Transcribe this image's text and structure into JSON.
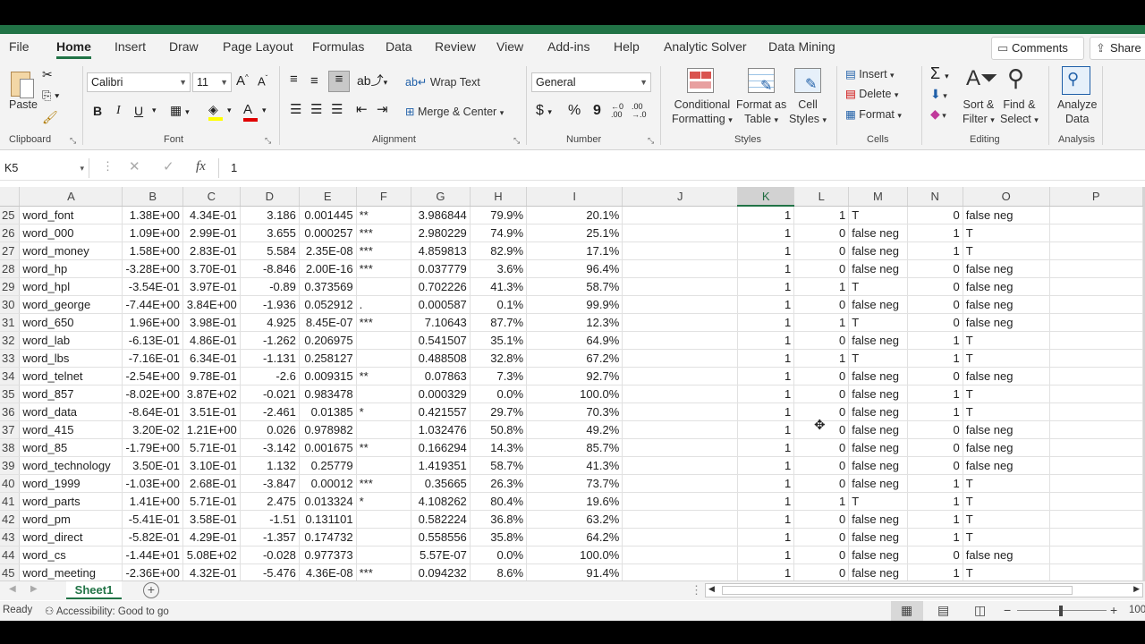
{
  "menu": {
    "tabs": [
      "File",
      "Home",
      "Insert",
      "Draw",
      "Page Layout",
      "Formulas",
      "Data",
      "Review",
      "View",
      "Add-ins",
      "Help",
      "Analytic Solver",
      "Data Mining"
    ],
    "active_tab": "Home",
    "comments_label": "Comments",
    "share_label": "Share"
  },
  "ribbon": {
    "clipboard": {
      "paste": "Paste",
      "label": "Clipboard"
    },
    "font": {
      "name": "Calibri",
      "size": "11",
      "grow": "A",
      "shrink": "A",
      "bold": "B",
      "italic": "I",
      "underline": "U",
      "label": "Font"
    },
    "alignment": {
      "wrap": "Wrap Text",
      "merge": "Merge & Center",
      "label": "Alignment"
    },
    "number": {
      "format": "General",
      "currency": "$",
      "percent": "%",
      "comma": "9",
      "label": "Number"
    },
    "styles": {
      "conditional1": "Conditional",
      "conditional2": "Formatting",
      "format_table1": "Format as",
      "format_table2": "Table",
      "cell_styles1": "Cell",
      "cell_styles2": "Styles",
      "label": "Styles"
    },
    "cells": {
      "insert": "Insert",
      "delete": "Delete",
      "format": "Format",
      "label": "Cells"
    },
    "editing": {
      "sort1": "Sort &",
      "sort2": "Filter",
      "find1": "Find &",
      "find2": "Select",
      "label": "Editing"
    },
    "analysis": {
      "analyze1": "Analyze",
      "analyze2": "Data",
      "label": "Analysis"
    }
  },
  "formula_bar": {
    "name_box": "K5",
    "fx": "fx",
    "value": "1"
  },
  "columns": [
    "A",
    "B",
    "C",
    "D",
    "E",
    "F",
    "G",
    "H",
    "I",
    "J",
    "K",
    "L",
    "M",
    "N",
    "O",
    "P"
  ],
  "selected_column": "K",
  "rows": [
    {
      "n": "25",
      "A": "word_font",
      "B": "1.38E+00",
      "C": "4.34E-01",
      "D": "3.186",
      "E": "0.001445",
      "F": "**",
      "G": "3.986844",
      "H": "79.9%",
      "I": "20.1%",
      "K": "1",
      "L": "1",
      "M": "T",
      "N": "0",
      "O": "false neg"
    },
    {
      "n": "26",
      "A": "word_000",
      "B": "1.09E+00",
      "C": "2.99E-01",
      "D": "3.655",
      "E": "0.000257",
      "F": "***",
      "G": "2.980229",
      "H": "74.9%",
      "I": "25.1%",
      "K": "1",
      "L": "0",
      "M": "false neg",
      "N": "1",
      "O": "T"
    },
    {
      "n": "27",
      "A": "word_money",
      "B": "1.58E+00",
      "C": "2.83E-01",
      "D": "5.584",
      "E": "2.35E-08",
      "F": "***",
      "G": "4.859813",
      "H": "82.9%",
      "I": "17.1%",
      "K": "1",
      "L": "0",
      "M": "false neg",
      "N": "1",
      "O": "T"
    },
    {
      "n": "28",
      "A": "word_hp",
      "B": "-3.28E+00",
      "C": "3.70E-01",
      "D": "-8.846",
      "E": "2.00E-16",
      "F": "***",
      "G": "0.037779",
      "H": "3.6%",
      "I": "96.4%",
      "K": "1",
      "L": "0",
      "M": "false neg",
      "N": "0",
      "O": "false neg"
    },
    {
      "n": "29",
      "A": "word_hpl",
      "B": "-3.54E-01",
      "C": "3.97E-01",
      "D": "-0.89",
      "E": "0.373569",
      "F": "",
      "G": "0.702226",
      "H": "41.3%",
      "I": "58.7%",
      "K": "1",
      "L": "1",
      "M": "T",
      "N": "0",
      "O": "false neg"
    },
    {
      "n": "30",
      "A": "word_george",
      "B": "-7.44E+00",
      "C": "3.84E+00",
      "D": "-1.936",
      "E": "0.052912",
      "F": ".",
      "G": "0.000587",
      "H": "0.1%",
      "I": "99.9%",
      "K": "1",
      "L": "0",
      "M": "false neg",
      "N": "0",
      "O": "false neg"
    },
    {
      "n": "31",
      "A": "word_650",
      "B": "1.96E+00",
      "C": "3.98E-01",
      "D": "4.925",
      "E": "8.45E-07",
      "F": "***",
      "G": "7.10643",
      "H": "87.7%",
      "I": "12.3%",
      "K": "1",
      "L": "1",
      "M": "T",
      "N": "0",
      "O": "false neg"
    },
    {
      "n": "32",
      "A": "word_lab",
      "B": "-6.13E-01",
      "C": "4.86E-01",
      "D": "-1.262",
      "E": "0.206975",
      "F": "",
      "G": "0.541507",
      "H": "35.1%",
      "I": "64.9%",
      "K": "1",
      "L": "0",
      "M": "false neg",
      "N": "1",
      "O": "T"
    },
    {
      "n": "33",
      "A": "word_lbs",
      "B": "-7.16E-01",
      "C": "6.34E-01",
      "D": "-1.131",
      "E": "0.258127",
      "F": "",
      "G": "0.488508",
      "H": "32.8%",
      "I": "67.2%",
      "K": "1",
      "L": "1",
      "M": "T",
      "N": "1",
      "O": "T"
    },
    {
      "n": "34",
      "A": "word_telnet",
      "B": "-2.54E+00",
      "C": "9.78E-01",
      "D": "-2.6",
      "E": "0.009315",
      "F": "**",
      "G": "0.07863",
      "H": "7.3%",
      "I": "92.7%",
      "K": "1",
      "L": "0",
      "M": "false neg",
      "N": "0",
      "O": "false neg"
    },
    {
      "n": "35",
      "A": "word_857",
      "B": "-8.02E+00",
      "C": "3.87E+02",
      "D": "-0.021",
      "E": "0.983478",
      "F": "",
      "G": "0.000329",
      "H": "0.0%",
      "I": "100.0%",
      "K": "1",
      "L": "0",
      "M": "false neg",
      "N": "1",
      "O": "T"
    },
    {
      "n": "36",
      "A": "word_data",
      "B": "-8.64E-01",
      "C": "3.51E-01",
      "D": "-2.461",
      "E": "0.01385",
      "F": "*",
      "G": "0.421557",
      "H": "29.7%",
      "I": "70.3%",
      "K": "1",
      "L": "0",
      "M": "false neg",
      "N": "1",
      "O": "T"
    },
    {
      "n": "37",
      "A": "word_415",
      "B": "3.20E-02",
      "C": "1.21E+00",
      "D": "0.026",
      "E": "0.978982",
      "F": "",
      "G": "1.032476",
      "H": "50.8%",
      "I": "49.2%",
      "K": "1",
      "L": "0",
      "M": "false neg",
      "N": "0",
      "O": "false neg"
    },
    {
      "n": "38",
      "A": "word_85",
      "B": "-1.79E+00",
      "C": "5.71E-01",
      "D": "-3.142",
      "E": "0.001675",
      "F": "**",
      "G": "0.166294",
      "H": "14.3%",
      "I": "85.7%",
      "K": "1",
      "L": "0",
      "M": "false neg",
      "N": "0",
      "O": "false neg"
    },
    {
      "n": "39",
      "A": "word_technology",
      "B": "3.50E-01",
      "C": "3.10E-01",
      "D": "1.132",
      "E": "0.25779",
      "F": "",
      "G": "1.419351",
      "H": "58.7%",
      "I": "41.3%",
      "K": "1",
      "L": "0",
      "M": "false neg",
      "N": "0",
      "O": "false neg"
    },
    {
      "n": "40",
      "A": "word_1999",
      "B": "-1.03E+00",
      "C": "2.68E-01",
      "D": "-3.847",
      "E": "0.00012",
      "F": "***",
      "G": "0.35665",
      "H": "26.3%",
      "I": "73.7%",
      "K": "1",
      "L": "0",
      "M": "false neg",
      "N": "1",
      "O": "T"
    },
    {
      "n": "41",
      "A": "word_parts",
      "B": "1.41E+00",
      "C": "5.71E-01",
      "D": "2.475",
      "E": "0.013324",
      "F": "*",
      "G": "4.108262",
      "H": "80.4%",
      "I": "19.6%",
      "K": "1",
      "L": "1",
      "M": "T",
      "N": "1",
      "O": "T"
    },
    {
      "n": "42",
      "A": "word_pm",
      "B": "-5.41E-01",
      "C": "3.58E-01",
      "D": "-1.51",
      "E": "0.131101",
      "F": "",
      "G": "0.582224",
      "H": "36.8%",
      "I": "63.2%",
      "K": "1",
      "L": "0",
      "M": "false neg",
      "N": "1",
      "O": "T"
    },
    {
      "n": "43",
      "A": "word_direct",
      "B": "-5.82E-01",
      "C": "4.29E-01",
      "D": "-1.357",
      "E": "0.174732",
      "F": "",
      "G": "0.558556",
      "H": "35.8%",
      "I": "64.2%",
      "K": "1",
      "L": "0",
      "M": "false neg",
      "N": "1",
      "O": "T"
    },
    {
      "n": "44",
      "A": "word_cs",
      "B": "-1.44E+01",
      "C": "5.08E+02",
      "D": "-0.028",
      "E": "0.977373",
      "F": "",
      "G": "5.57E-07",
      "H": "0.0%",
      "I": "100.0%",
      "K": "1",
      "L": "0",
      "M": "false neg",
      "N": "0",
      "O": "false neg"
    },
    {
      "n": "45",
      "A": "word_meeting",
      "B": "-2.36E+00",
      "C": "4.32E-01",
      "D": "-5.476",
      "E": "4.36E-08",
      "F": "***",
      "G": "0.094232",
      "H": "8.6%",
      "I": "91.4%",
      "K": "1",
      "L": "0",
      "M": "false neg",
      "N": "1",
      "O": "T"
    }
  ],
  "sheet": {
    "name": "Sheet1"
  },
  "status": {
    "ready": "Ready",
    "accessibility": "Accessibility: Good to go",
    "zoom": "100"
  }
}
